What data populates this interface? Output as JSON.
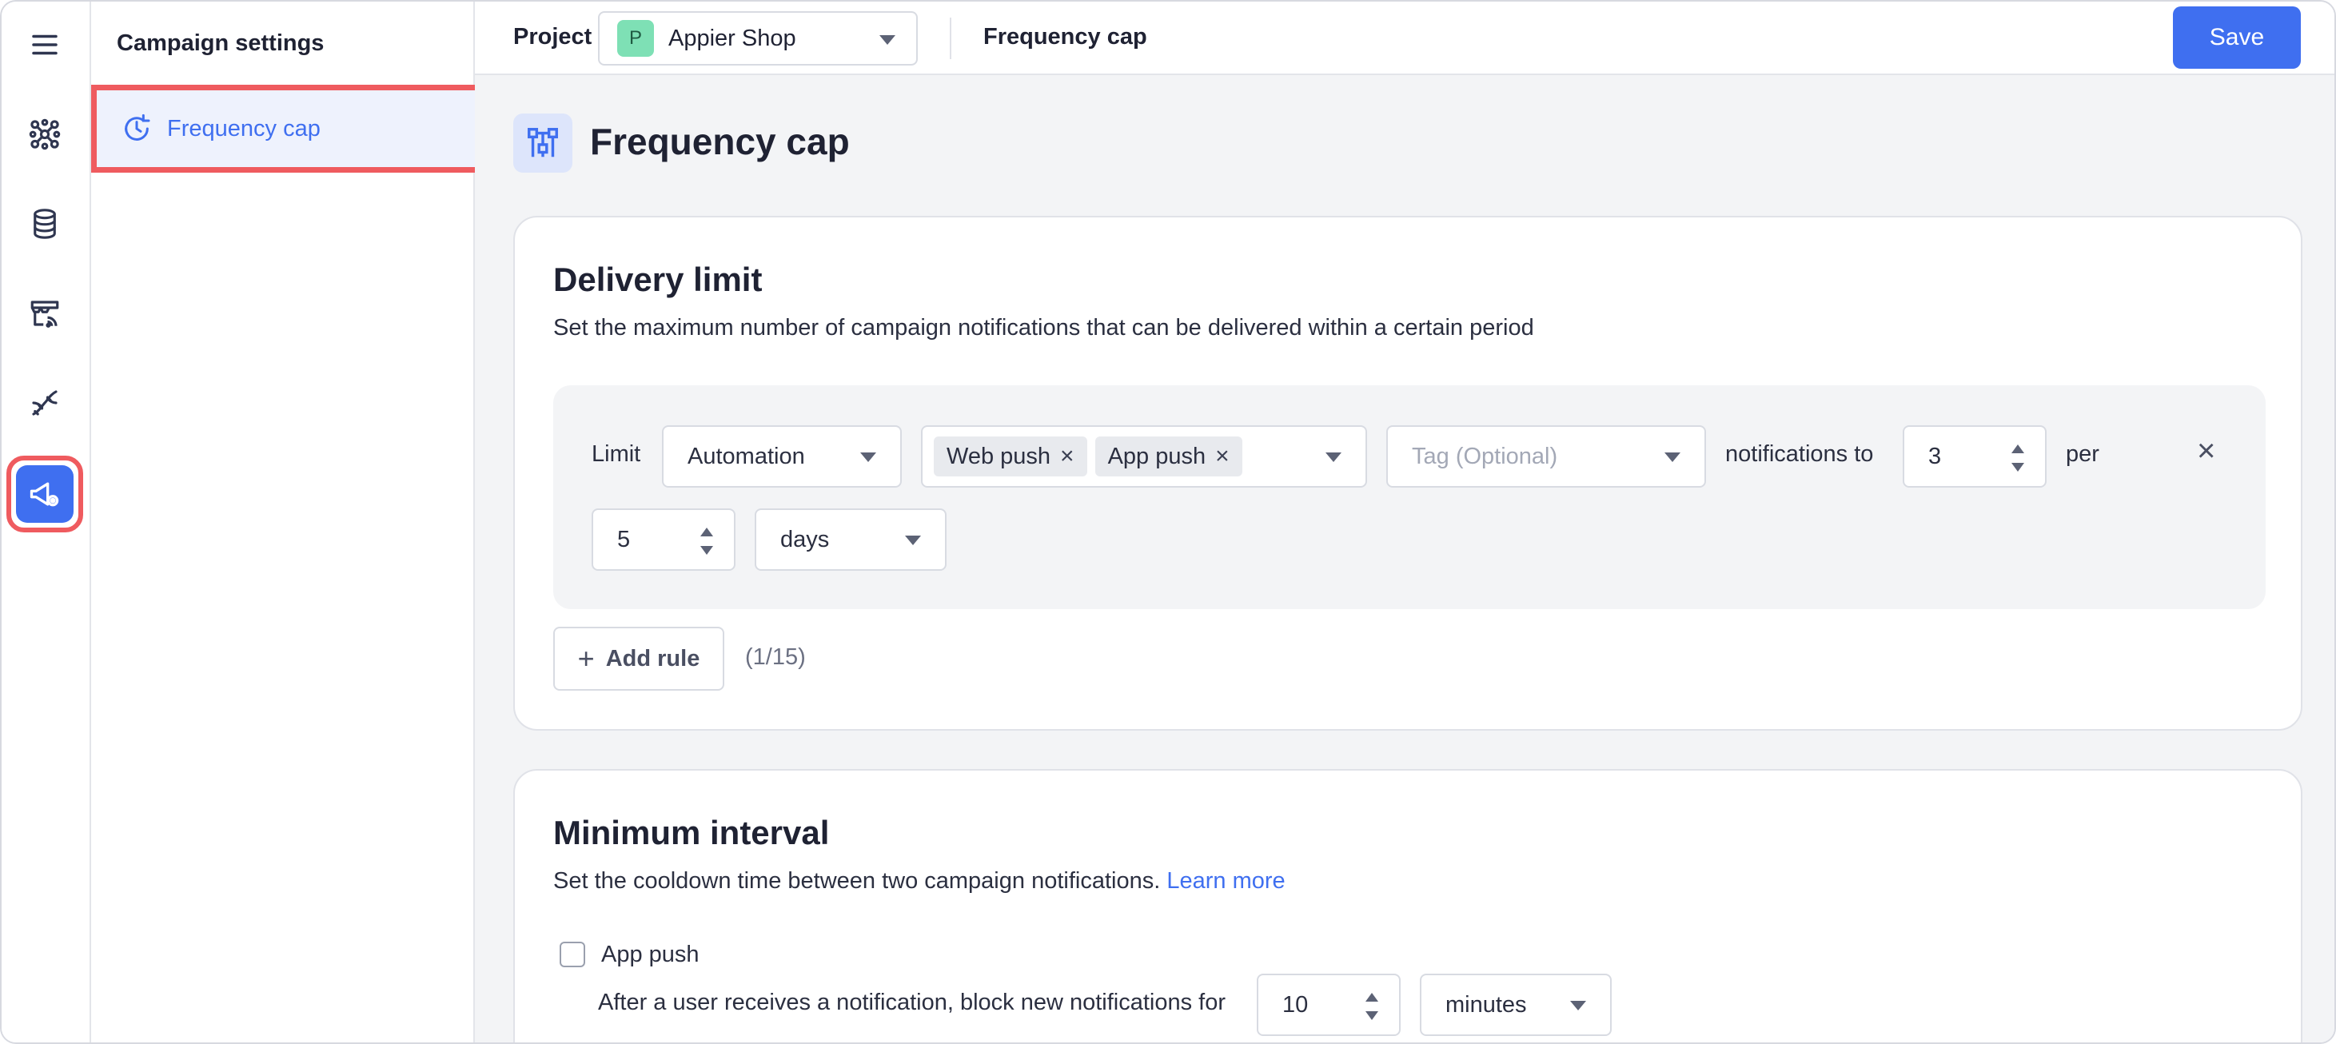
{
  "rail": {
    "items": [
      {
        "icon": "menu-icon"
      },
      {
        "icon": "network-icon"
      },
      {
        "icon": "database-icon"
      },
      {
        "icon": "store-signal-icon"
      },
      {
        "icon": "dna-icon"
      },
      {
        "icon": "campaign-settings-icon",
        "active": true
      }
    ]
  },
  "sidebar": {
    "title": "Campaign settings",
    "items": [
      {
        "label": "Frequency cap",
        "icon": "clock-refresh-icon",
        "selected": true
      }
    ]
  },
  "topbar": {
    "project_label": "Project",
    "project_badge": "P",
    "project_name": "Appier Shop",
    "page_label": "Frequency cap",
    "save_label": "Save"
  },
  "page": {
    "title": "Frequency cap"
  },
  "delivery_limit": {
    "title": "Delivery limit",
    "description": "Set the maximum number of campaign notifications that can be delivered within a certain period",
    "rule": {
      "limit_label": "Limit",
      "type_value": "Automation",
      "channels": [
        "Web push",
        "App push"
      ],
      "tag_placeholder": "Tag (Optional)",
      "notifications_to_label": "notifications to",
      "count_value": "3",
      "per_label": "per",
      "period_value": "5",
      "unit_value": "days"
    },
    "add_rule_label": "Add rule",
    "rule_count": "(1/15)"
  },
  "minimum_interval": {
    "title": "Minimum interval",
    "description": "Set the cooldown time between two campaign notifications.",
    "learn_more": "Learn more",
    "app_push_label": "App push",
    "block_text": "After a user receives a notification, block new notifications for",
    "interval_value": "10",
    "interval_unit": "minutes"
  },
  "colors": {
    "accent": "#3f6ff0",
    "highlight": "#ef5b5f",
    "badge": "#7ee0b5"
  }
}
